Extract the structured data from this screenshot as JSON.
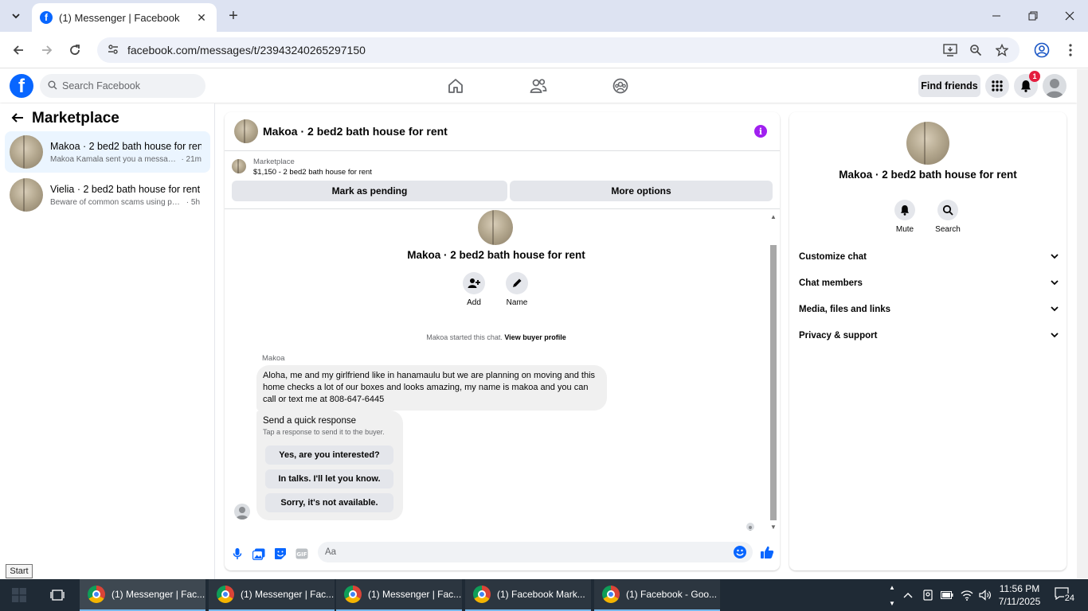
{
  "browser": {
    "tab_title": "(1) Messenger | Facebook",
    "url": "facebook.com/messages/t/23943240265297150"
  },
  "facebook": {
    "search_placeholder": "Search Facebook",
    "find_friends": "Find friends",
    "notification_count": "1"
  },
  "left": {
    "title": "Marketplace",
    "conversations": [
      {
        "name": "Makoa · 2 bed2 bath house for rent",
        "preview": "Makoa Kamala sent you a message ...",
        "time": "· 21m"
      },
      {
        "name": "Vielia · 2 bed2 bath house for rent",
        "preview": "Beware of common scams using pay...",
        "time": "· 5h"
      }
    ]
  },
  "chat": {
    "title": "Makoa · 2 bed2 bath house for rent",
    "listing_source": "Marketplace",
    "listing": "$1,150 - 2 bed2 bath house for rent",
    "mark_pending": "Mark as pending",
    "more_options": "More options",
    "add_label": "Add",
    "name_label": "Name",
    "started_text": "Makoa started this chat.",
    "view_buyer": "View buyer profile",
    "sender": "Makoa",
    "message": "Aloha, me and my girlfriend like in hanamaulu but we are planning on moving and this home checks a lot of our boxes and looks amazing, my name is makoa and you can call or text me at 808-647-6445",
    "quick_title": "Send a quick response",
    "quick_sub": "Tap a response to send it to the buyer.",
    "quick_responses": [
      "Yes, are you interested?",
      "In talks. I'll let you know.",
      "Sorry, it's not available."
    ],
    "composer_placeholder": "Aa"
  },
  "info": {
    "name": "Makoa · 2 bed2 bath house for rent",
    "mute": "Mute",
    "search": "Search",
    "sections": [
      "Customize chat",
      "Chat members",
      "Media, files and links",
      "Privacy & support"
    ]
  },
  "taskbar": {
    "start_tooltip": "Start",
    "items": [
      "(1) Messenger | Fac...",
      "(1) Messenger | Fac...",
      "(1) Messenger | Fac...",
      "(1) Facebook Mark...",
      "(1) Facebook - Goo..."
    ],
    "time": "11:56 PM",
    "date": "7/11/2025",
    "notifications": "24"
  },
  "colors": {
    "facebook_blue": "#0866ff",
    "info_purple": "#a020f0",
    "badge_red": "#e41e3f",
    "taskbar": "#1f2a35"
  }
}
